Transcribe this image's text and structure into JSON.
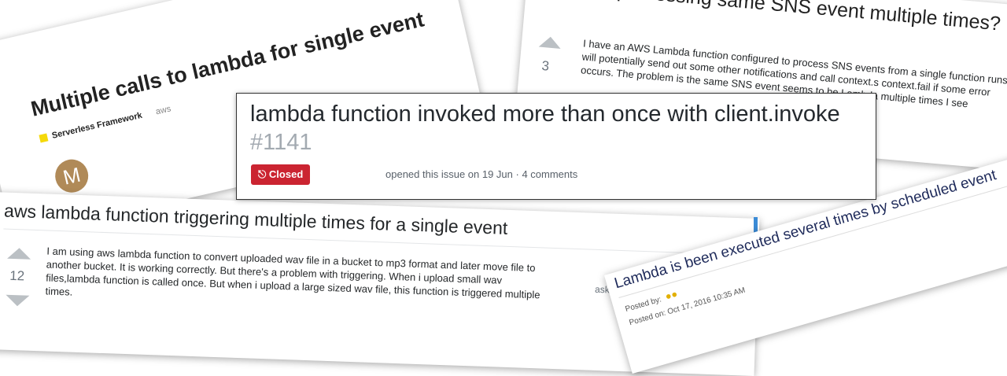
{
  "card_forum_serverless": {
    "title": "Multiple calls to lambda for single event",
    "tag_primary": "Serverless Framework",
    "tag_secondary": "aws",
    "avatar_letter": "M",
    "tag_color": "#f5d90a"
  },
  "card_so_sns": {
    "title": "Lambda processing same SNS event multiple times?",
    "vote_count": "3",
    "body": "I have an AWS Lambda function configured to process SNS events from a single function runs it will potentially send out some other notifications and call context.s context.fail if some error occurs. The problem is the same SNS event seems to be Lambda multiple times I see"
  },
  "card_github_issue": {
    "title": "lambda function invoked more than once with client.invoke",
    "number": "#1141",
    "status": "Closed",
    "status_color": "#cb2431",
    "meta": "opened this issue on 19 Jun · 4 comments"
  },
  "card_so_s3": {
    "title": "aws lambda function triggering multiple times for a single event",
    "vote_count": "12",
    "body": "I am using aws lambda function to convert uploaded wav file in a bucket to mp3 format and later move file to another bucket. It is working correctly. But there's a problem with triggering. When i upload small wav files,lambda function is called once. But when i upload a large sized wav file, this function is triggered multiple times.",
    "asked": "asked"
  },
  "card_forum_scheduled": {
    "title": "Lambda is been executed several times by scheduled event",
    "posted_by": "Posted by:",
    "posted_on": "Posted on: Oct 17, 2016 10:35 AM"
  }
}
